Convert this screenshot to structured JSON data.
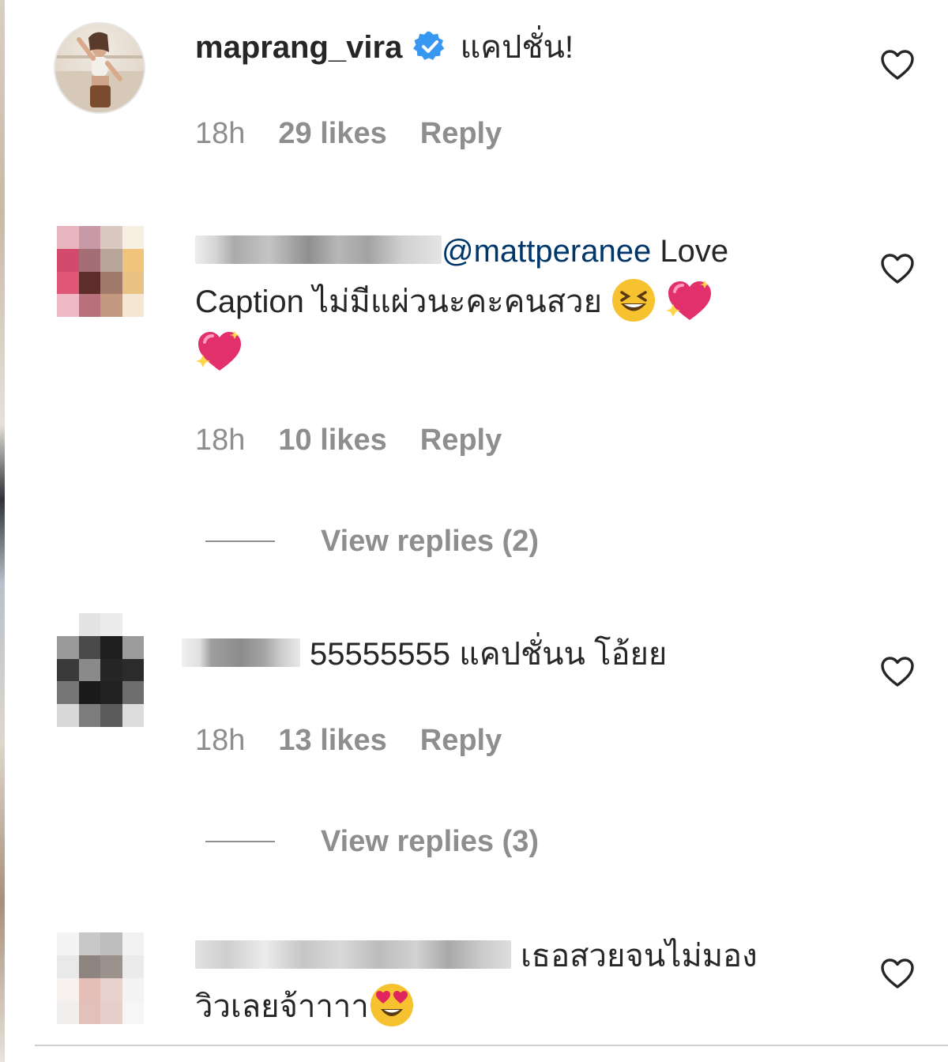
{
  "colors": {
    "text": "#262626",
    "muted": "#8e8e8e",
    "mention": "#00376b",
    "verified": "#3897f0"
  },
  "comments": [
    {
      "username": "maprang_vira",
      "verified": true,
      "text": "แคปชั่น!",
      "time": "18h",
      "likes": "29 likes",
      "reply_label": "Reply"
    },
    {
      "mention": "@mattperanee",
      "text_line1": "Love",
      "text_line2": "Caption ไม่มีแผ่วนะคะคนสวย",
      "emojis": [
        "grinning-squinting-face",
        "sparkling-heart",
        "sparkling-heart"
      ],
      "time": "18h",
      "likes": "10 likes",
      "reply_label": "Reply",
      "view_replies": "View replies (2)"
    },
    {
      "text": "55555555 แคปชั่นน โอ้ยย",
      "time": "18h",
      "likes": "13 likes",
      "reply_label": "Reply",
      "view_replies": "View replies (3)"
    },
    {
      "text_line1": "เธอสวยจนไม่มอง",
      "text_line2": "วิวเลยจ้าาาา",
      "emojis": [
        "heart-eyes-face"
      ]
    }
  ],
  "icons": {
    "like": "heart-outline-icon",
    "verified": "verified-badge-icon"
  }
}
